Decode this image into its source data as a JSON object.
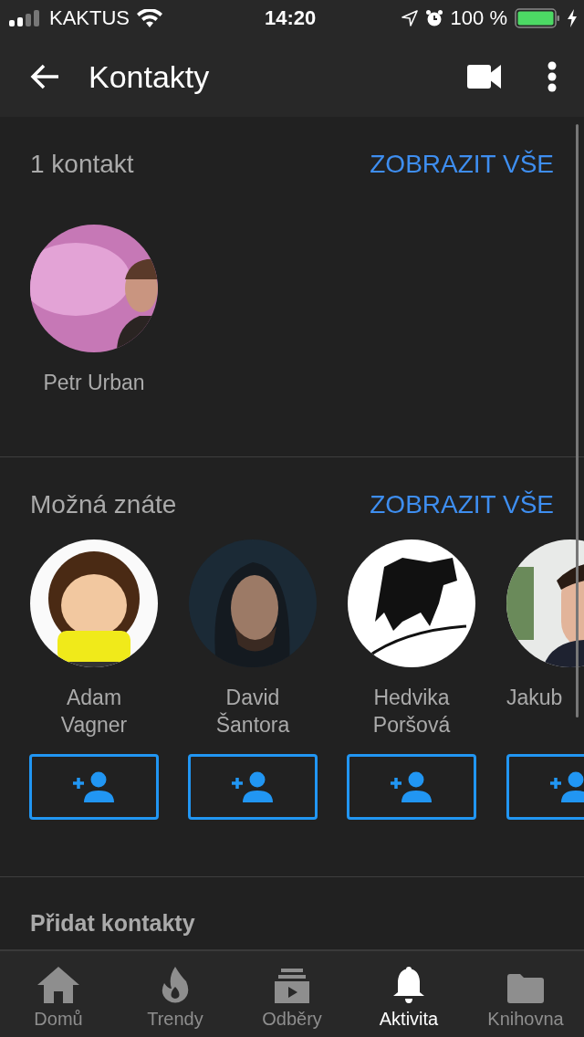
{
  "status_bar": {
    "carrier": "KAKTUS",
    "time": "14:20",
    "battery": "100 %"
  },
  "header": {
    "title": "Kontakty"
  },
  "contacts": {
    "title": "1 kontakt",
    "action": "ZOBRAZIT VŠE",
    "people": [
      {
        "name": "Petr Urban"
      }
    ]
  },
  "suggestions": {
    "title": "Možná znáte",
    "action": "ZOBRAZIT VŠE",
    "people": [
      {
        "name": "Adam Vagner"
      },
      {
        "name": "David Šantora"
      },
      {
        "name": "Hedvika Poršová"
      },
      {
        "name": "Jakub"
      }
    ]
  },
  "add_contacts": {
    "title": "Přidat kontakty"
  },
  "bottom_nav": [
    {
      "label": "Domů",
      "selected": false
    },
    {
      "label": "Trendy",
      "selected": false
    },
    {
      "label": "Odběry",
      "selected": false
    },
    {
      "label": "Aktivita",
      "selected": true
    },
    {
      "label": "Knihovna",
      "selected": false
    }
  ]
}
